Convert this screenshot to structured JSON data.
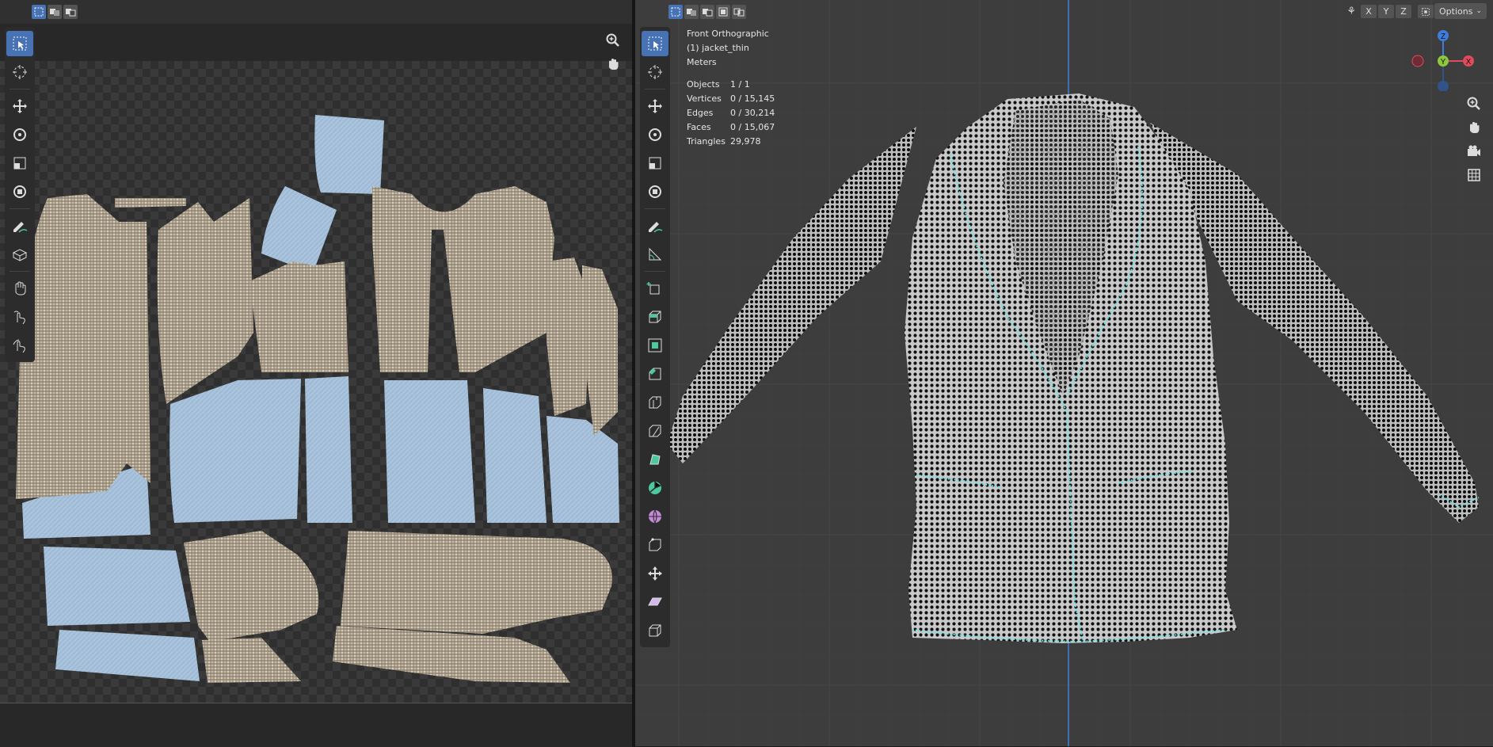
{
  "uv_editor": {
    "header": {
      "select_modes": [
        "select-new",
        "select-extend",
        "select-subtract"
      ]
    },
    "tools": [
      "select-box",
      "cursor",
      "move",
      "rotate",
      "scale",
      "transform",
      "annotate",
      "rip",
      "grab",
      "relax",
      "pinch"
    ]
  },
  "viewport": {
    "info": {
      "view": "Front Orthographic",
      "object": "(1) jacket_thin",
      "units": "Meters"
    },
    "stats": [
      {
        "label": "Objects",
        "value": "1 / 1"
      },
      {
        "label": "Vertices",
        "value": "0 / 15,145"
      },
      {
        "label": "Edges",
        "value": "0 / 30,214"
      },
      {
        "label": "Faces",
        "value": "0 / 15,067"
      },
      {
        "label": "Triangles",
        "value": "29,978"
      }
    ],
    "axes": {
      "x": "X",
      "y": "Y",
      "z": "Z"
    },
    "options_label": "Options",
    "gizmo": {
      "x": "X",
      "y": "Y",
      "z": "Z"
    },
    "colors": {
      "x": "#e04b5c",
      "y": "#8dc63f",
      "z": "#3e7edb",
      "seam": "#5fe6e6",
      "accent": "#4772b3"
    }
  }
}
